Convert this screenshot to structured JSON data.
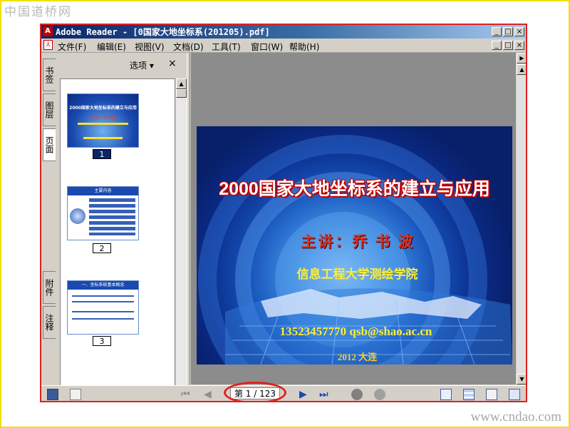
{
  "watermarks": {
    "top_left": "中国道桥网",
    "bottom_right": "www.cndao.com"
  },
  "window": {
    "title": "Adobe Reader - [0国家大地坐标系(201205).pdf]",
    "controls": {
      "minimize": "_",
      "maximize": "□",
      "close": "×"
    }
  },
  "menu": [
    "文件(F)",
    "编辑(E)",
    "视图(V)",
    "文档(D)",
    "工具(T)",
    "窗口(W)",
    "帮助(H)"
  ],
  "side_tabs": {
    "bookmarks": "书签",
    "layers": "图层",
    "pages": "页面",
    "attachments": "附件",
    "comments": "注释"
  },
  "panel": {
    "options_label": "选项 ▾",
    "close": "×"
  },
  "thumbnails": [
    {
      "number": "1",
      "title": "2000国家大地坐标系的建立与应用",
      "subtitle": "主讲：乔书波",
      "selected": true
    },
    {
      "number": "2",
      "title": "主要内容",
      "selected": false
    },
    {
      "number": "3",
      "title": "一、坐标系统基本概念",
      "selected": false
    }
  ],
  "slide": {
    "title": "2000国家大地坐标系的建立与应用",
    "speaker": "主讲：乔 书 波",
    "institution": "信息工程大学测绘学院",
    "contact": "13523457770  qsb@shao.ac.cn",
    "year": "2012 大连"
  },
  "status": {
    "page_indicator": "第 1 / 123 页",
    "nav": {
      "first": "⏮",
      "prev": "◀",
      "next": "▶",
      "last": "⏭"
    }
  },
  "colors": {
    "highlight_oval": "#e02020",
    "titlebar": "#0a246a",
    "slide_bg": "#0a2a85"
  }
}
